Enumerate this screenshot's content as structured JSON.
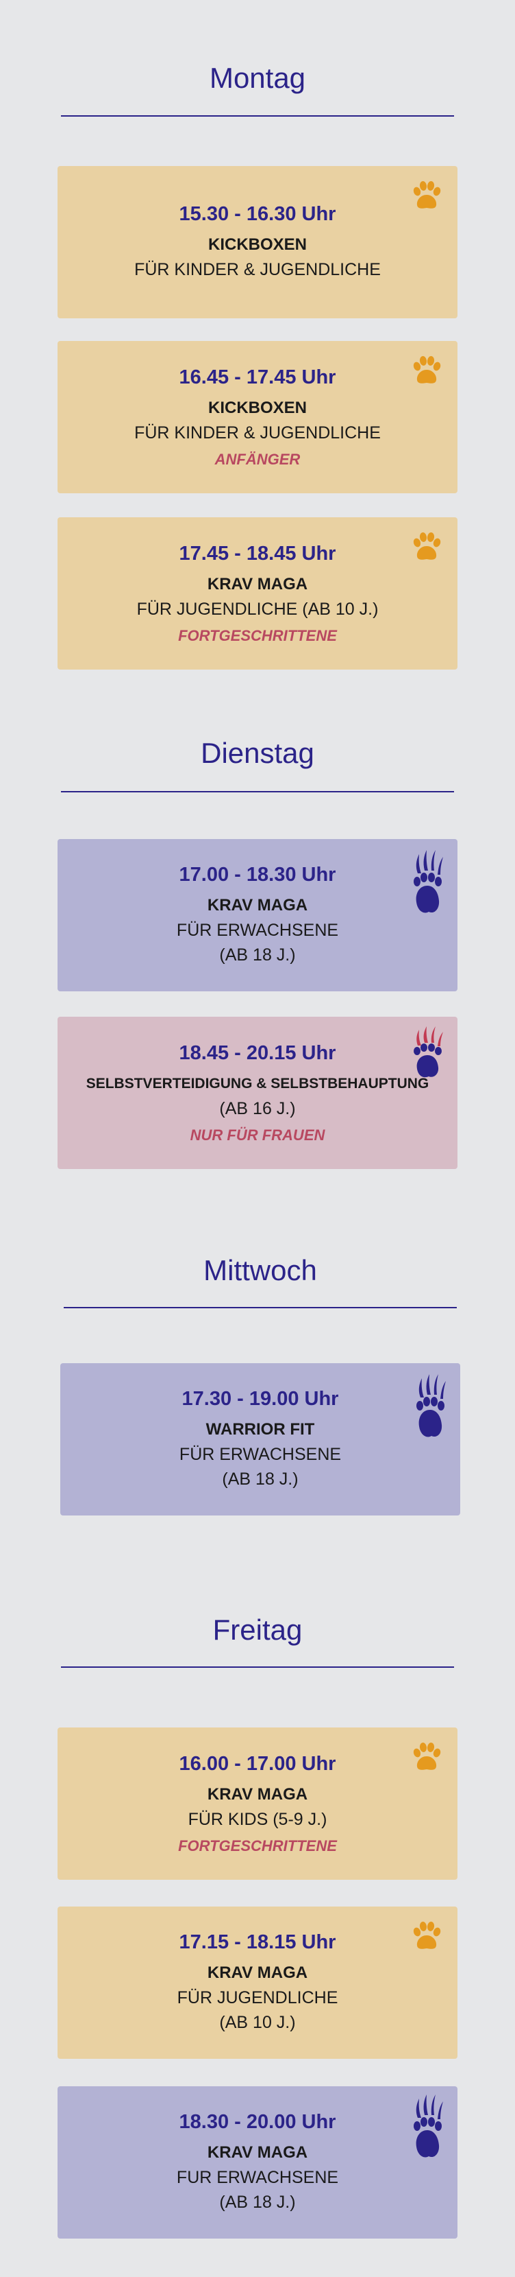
{
  "days": [
    {
      "name": "Montag",
      "classes": [
        {
          "time": "15.30 - 16.30 Uhr",
          "title": "KICKBOXEN",
          "audience": [
            "FÜR KINDER & JUGENDLICHE"
          ],
          "level": "",
          "icon": "paw-icon",
          "color": "#e9d1a2"
        },
        {
          "time": "16.45 - 17.45 Uhr",
          "title": "KICKBOXEN",
          "audience": [
            "FÜR KINDER & JUGENDLICHE"
          ],
          "level": "ANFÄNGER",
          "icon": "paw-icon",
          "color": "#e9d1a2"
        },
        {
          "time": "17.45 - 18.45 Uhr",
          "title": "KRAV MAGA",
          "audience": [
            "FÜR JUGENDLICHE (AB 10 J.)"
          ],
          "level": "FORTGESCHRITTENE",
          "icon": "paw-icon",
          "color": "#e9d1a2"
        }
      ]
    },
    {
      "name": "Dienstag",
      "classes": [
        {
          "time": "17.00 - 18.30 Uhr",
          "title": "KRAV MAGA",
          "audience": [
            "FÜR ERWACHSENE",
            "(AB 18 J.)"
          ],
          "level": "",
          "icon": "claw-paw-icon",
          "color": "#b3b2d4"
        },
        {
          "time": "18.45 - 20.15 Uhr",
          "title": "SELBSTVERTEIDIGUNG & SELBSTBEHAUPTUNG",
          "audience": [
            "(AB 16 J.)"
          ],
          "level": "NUR FÜR FRAUEN",
          "icon": "claw-paw-icon",
          "color": "#d7bcc6"
        }
      ]
    },
    {
      "name": "Mittwoch",
      "classes": [
        {
          "time": "17.30 - 19.00 Uhr",
          "title": "WARRIOR FIT",
          "audience": [
            "FÜR ERWACHSENE",
            "(AB 18 J.)"
          ],
          "level": "",
          "icon": "claw-paw-icon",
          "color": "#b3b2d4"
        }
      ]
    },
    {
      "name": "Freitag",
      "classes": [
        {
          "time": "16.00 - 17.00 Uhr",
          "title": "KRAV MAGA",
          "audience": [
            "FÜR KIDS (5-9 J.)"
          ],
          "level": "FORTGESCHRITTENE",
          "icon": "paw-icon",
          "color": "#e9d1a2"
        },
        {
          "time": "17.15 - 18.15 Uhr",
          "title": "KRAV MAGA",
          "audience": [
            "FÜR JUGENDLICHE",
            "(AB 10 J.)"
          ],
          "level": "",
          "icon": "paw-icon",
          "color": "#e9d1a2"
        },
        {
          "time": "18.30 - 20.00 Uhr",
          "title": "KRAV MAGA",
          "audience": [
            "FUR ERWACHSENE",
            "(AB 18 J.)"
          ],
          "level": "",
          "icon": "claw-paw-icon",
          "color": "#b3b2d4"
        }
      ]
    }
  ],
  "colors": {
    "heading": "#2b2389",
    "level": "#b84860",
    "paw_orange": "#e59a1f",
    "paw_blue": "#2b2389"
  }
}
